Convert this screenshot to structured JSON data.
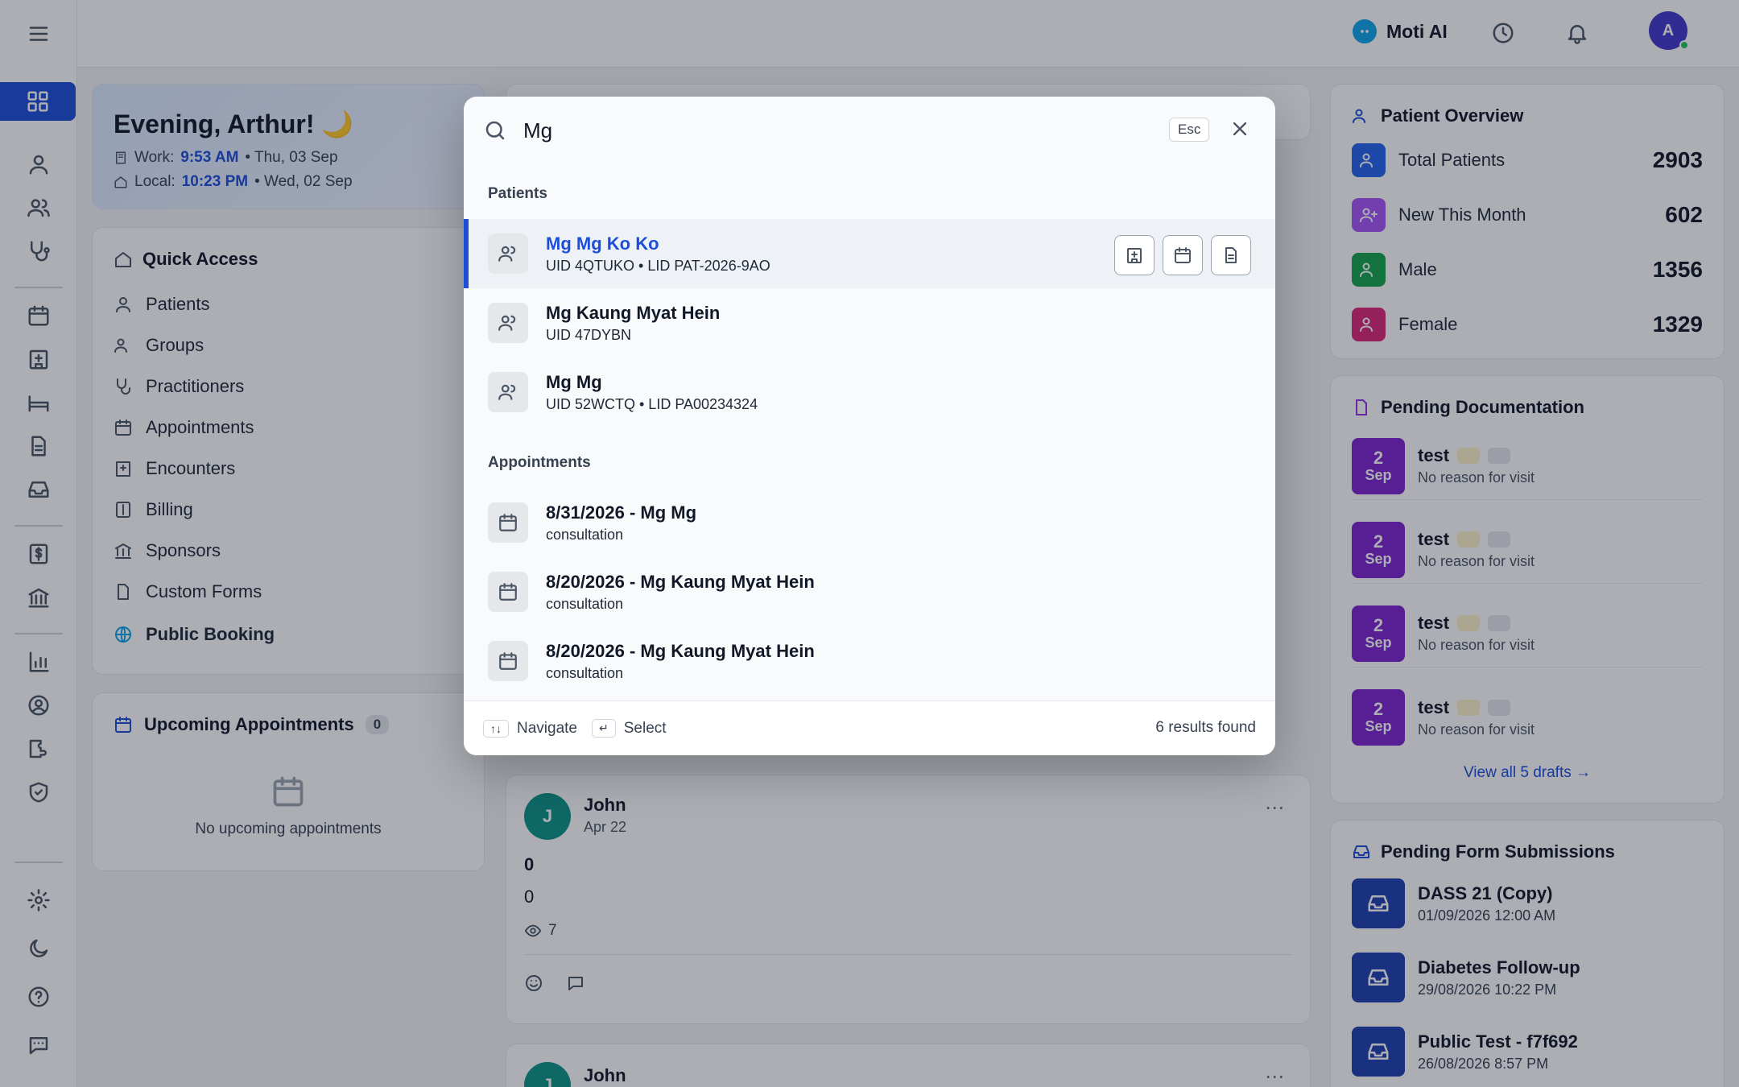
{
  "colors": {
    "accent": "#1d4ed8",
    "overlay": "rgba(17,24,39,0.35)"
  },
  "topbar": {
    "assistant_label": "Moti AI",
    "avatar_initial": "A"
  },
  "greeting": {
    "title": "Evening, Arthur! 🌙",
    "work_label": "Work:",
    "work_time": "9:53 AM",
    "work_date": "• Thu, 03 Sep",
    "local_label": "Local:",
    "local_time": "10:23 PM",
    "local_date": "• Wed, 02 Sep"
  },
  "quick_access": {
    "title": "Quick Access",
    "items": [
      "Patients",
      "Groups",
      "Practitioners",
      "Appointments",
      "Encounters",
      "Billing",
      "Sponsors",
      "Custom Forms"
    ],
    "public_booking": "Public Booking"
  },
  "upcoming": {
    "title": "Upcoming Appointments",
    "count": "0",
    "empty": "No upcoming appointments"
  },
  "feed": {
    "post2": {
      "avatar": "J",
      "author": "John",
      "date": "Apr 22",
      "title": "0",
      "body": "0",
      "views": "7"
    },
    "post3": {
      "avatar": "J",
      "author": "John"
    }
  },
  "patient_overview": {
    "title": "Patient Overview",
    "stats": [
      {
        "label": "Total Patients",
        "value": "2903",
        "color": "#2563eb"
      },
      {
        "label": "New This Month",
        "value": "602",
        "color": "#a855f7"
      },
      {
        "label": "Male",
        "value": "1356",
        "color": "#16a34a"
      },
      {
        "label": "Female",
        "value": "1329",
        "color": "#db2777"
      }
    ]
  },
  "pending_docs": {
    "title": "Pending Documentation",
    "items": [
      {
        "day": "2",
        "month": "Sep",
        "name": "test",
        "reason": "No reason for visit"
      },
      {
        "day": "2",
        "month": "Sep",
        "name": "test",
        "reason": "No reason for visit"
      },
      {
        "day": "2",
        "month": "Sep",
        "name": "test",
        "reason": "No reason for visit"
      },
      {
        "day": "2",
        "month": "Sep",
        "name": "test",
        "reason": "No reason for visit"
      }
    ],
    "view_all": "View all 5 drafts →"
  },
  "pending_forms": {
    "title": "Pending Form Submissions",
    "items": [
      {
        "name": "DASS 21 (Copy)",
        "date": "01/09/2026 12:00 AM"
      },
      {
        "name": "Diabetes Follow-up",
        "date": "29/08/2026 10:22 PM"
      },
      {
        "name": "Public Test - f7f692",
        "date": "26/08/2026 8:57 PM"
      }
    ]
  },
  "search": {
    "query": "Mg",
    "esc_label": "Esc",
    "patients_label": "Patients",
    "patients": [
      {
        "name": "Mg Mg Ko Ko",
        "sub": "UID 4QTUKO • LID PAT-2026-9AO"
      },
      {
        "name": "Mg Kaung Myat Hein",
        "sub": "UID 47DYBN"
      },
      {
        "name": "Mg Mg",
        "sub": "UID 52WCTQ • LID PA00234324"
      }
    ],
    "appointments_label": "Appointments",
    "appointments": [
      {
        "title": "8/31/2026 - Mg Mg",
        "sub": "consultation"
      },
      {
        "title": "8/20/2026 - Mg Kaung Myat Hein",
        "sub": "consultation"
      },
      {
        "title": "8/20/2026 - Mg Kaung Myat Hein",
        "sub": "consultation"
      }
    ],
    "footer": {
      "navigate_key": "↑↓",
      "navigate": "Navigate",
      "select_key": "↵",
      "select": "Select",
      "count": "6 results found"
    }
  }
}
